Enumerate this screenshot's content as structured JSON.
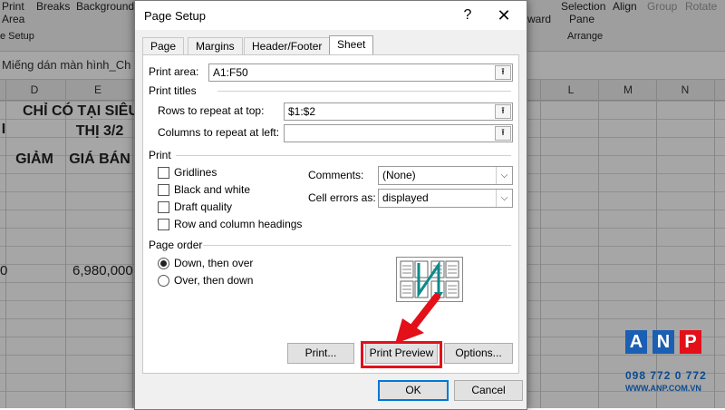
{
  "ribbon": {
    "print_area_top": "Print",
    "print_area_bottom": "Area",
    "breaks": "Breaks",
    "background": "Background",
    "page_setup_group": "e Setup",
    "forward": "ward",
    "selection_pane_top": "Selection",
    "selection_pane_bottom": "Pane",
    "align": "Align",
    "group": "Group",
    "rotate": "Rotate",
    "arrange_group": "Arrange"
  },
  "formula_bar": {
    "text": "Miếng dán màn hình_Ch"
  },
  "sheet": {
    "columns": [
      "D",
      "E",
      "L",
      "M",
      "N"
    ],
    "header_line1": "CHỈ CÓ TẠI SIÊU",
    "header_line2": "THỊ 3/2",
    "col_d_header": "GIẢM",
    "col_e_header": "GIÁ BÁN",
    "left_fragment_top": "I",
    "price_value": "6,980,000",
    "left_fragment_value": "0"
  },
  "dialog": {
    "title": "Page Setup",
    "help": "?",
    "close": "✕",
    "tabs": [
      "Page",
      "Margins",
      "Header/Footer",
      "Sheet"
    ],
    "print_area_label": "Print area:",
    "print_area_value": "A1:F50",
    "print_titles_group": "Print titles",
    "rows_repeat_label": "Rows to repeat at top:",
    "rows_repeat_value": "$1:$2",
    "cols_repeat_label": "Columns to repeat at left:",
    "cols_repeat_value": "",
    "print_group": "Print",
    "checkboxes": [
      "Gridlines",
      "Black and white",
      "Draft quality",
      "Row and column headings"
    ],
    "comments_label": "Comments:",
    "comments_value": "(None)",
    "cell_errors_label": "Cell errors as:",
    "cell_errors_value": "displayed",
    "page_order_group": "Page order",
    "radio_down": "Down, then over",
    "radio_over": "Over, then down",
    "print_btn": "Print...",
    "print_preview_btn": "Print Preview",
    "options_btn": "Options...",
    "ok_btn": "OK",
    "cancel_btn": "Cancel"
  },
  "logo": {
    "letters": [
      "A",
      "N",
      "P"
    ],
    "phone": "098 772 0 772",
    "web": "WWW.ANP.COM.VN",
    "colors": {
      "a": "#1a5fb4",
      "n": "#1a5fb4",
      "p": "#e3101a"
    }
  },
  "annotation": {
    "color": "#e3101a"
  }
}
